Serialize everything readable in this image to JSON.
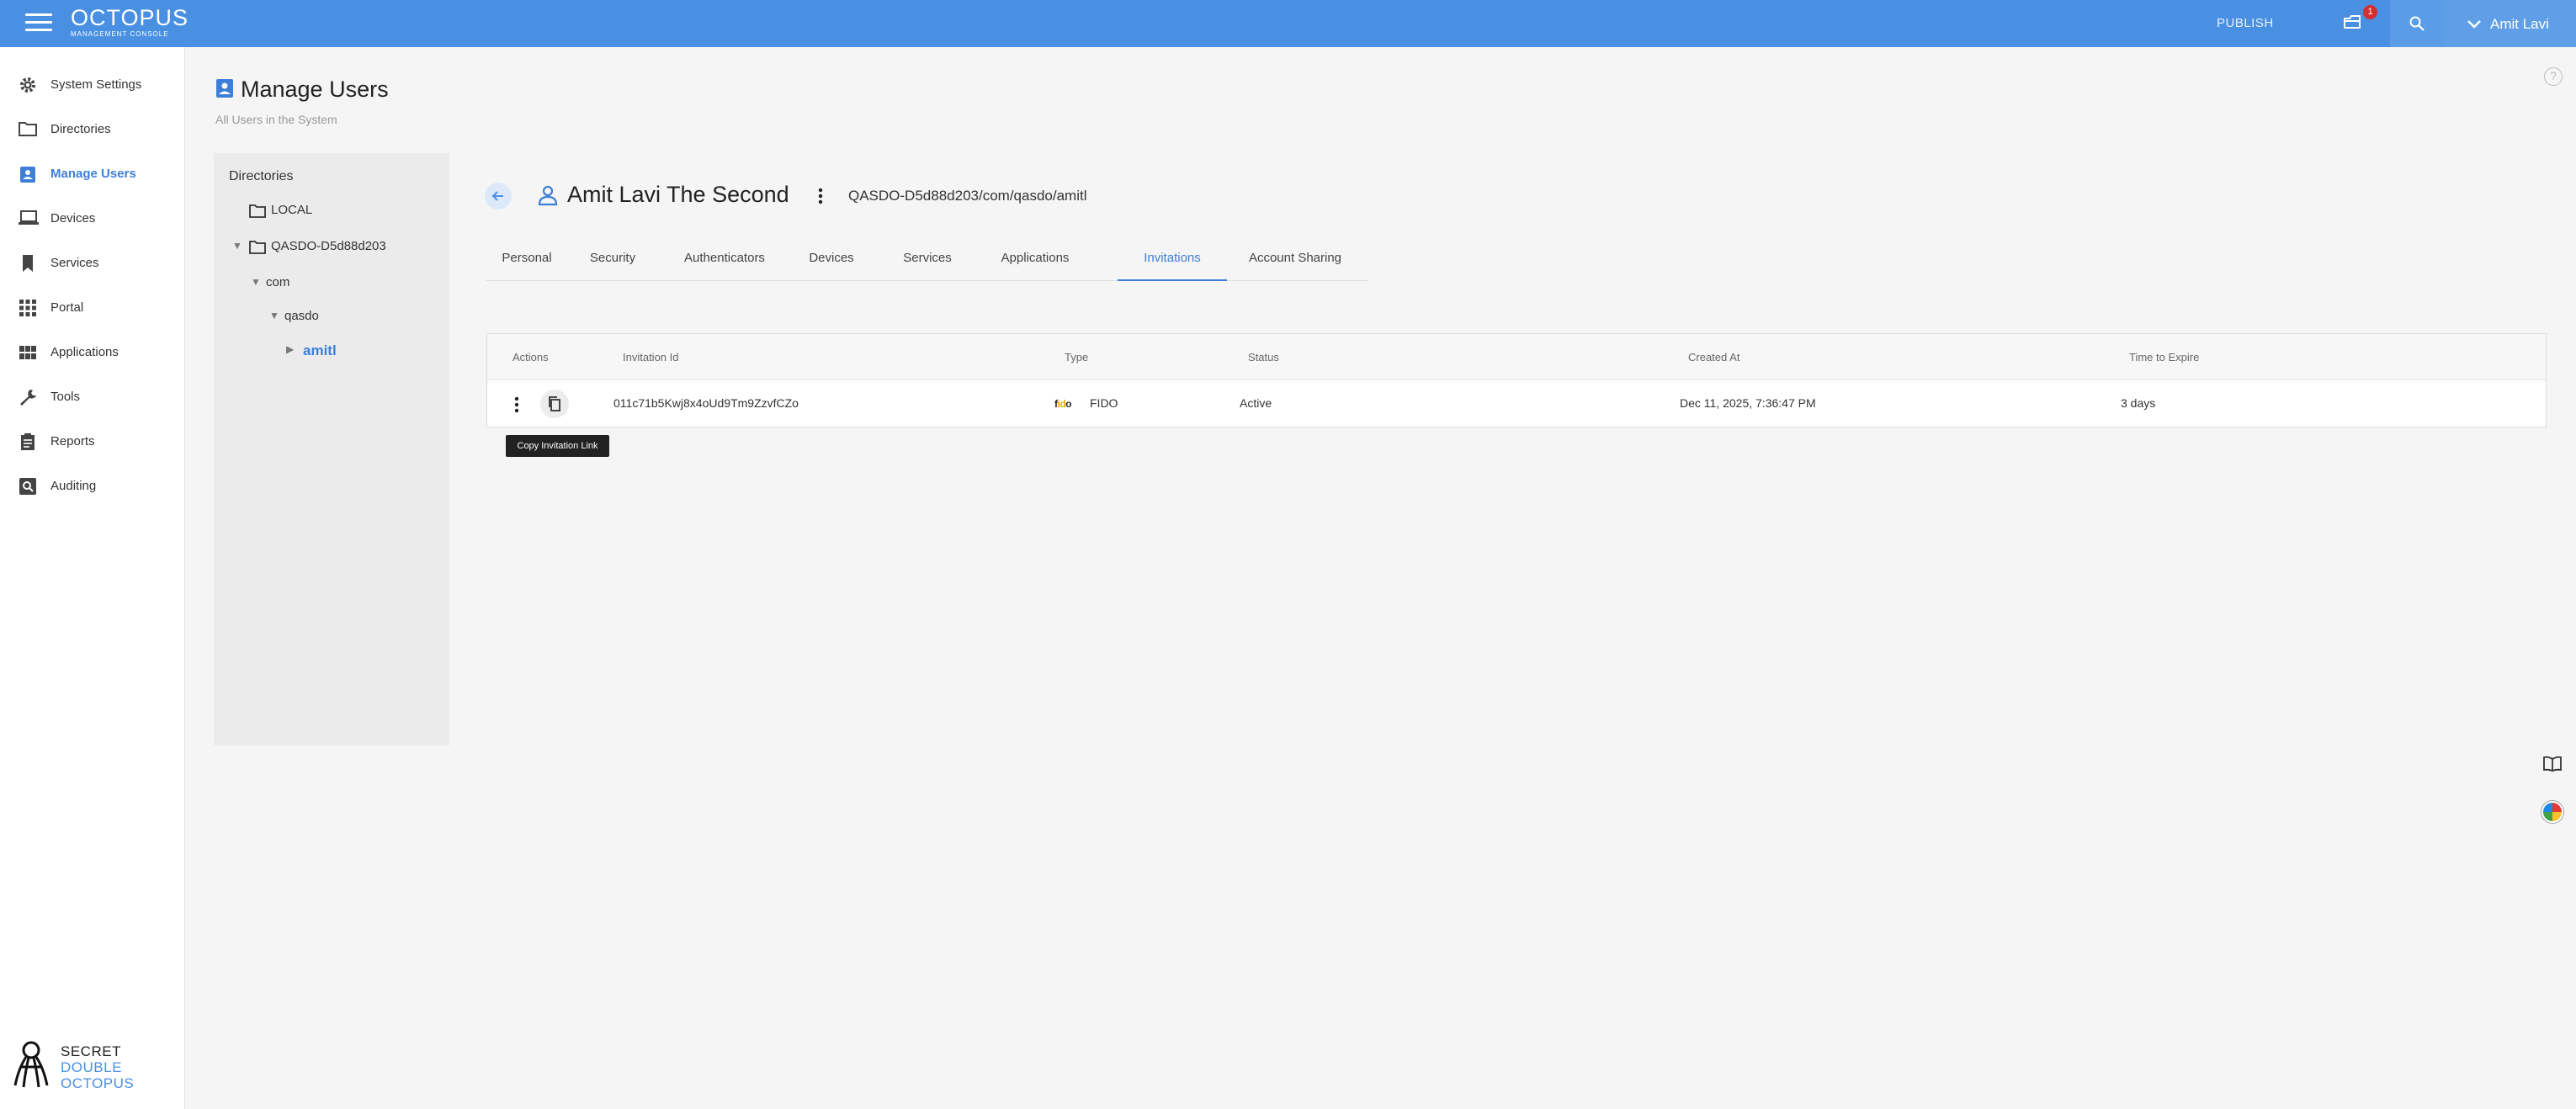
{
  "topbar": {
    "brand_title": "OCTOPUS",
    "brand_subtitle": "MANAGEMENT CONSOLE",
    "publish_label": "PUBLISH",
    "inbox_badge": "1",
    "user_name": "Amit Lavi"
  },
  "sidebar": {
    "items": [
      {
        "label": "System Settings",
        "icon": "gear-icon"
      },
      {
        "label": "Directories",
        "icon": "folder-icon"
      },
      {
        "label": "Manage Users",
        "icon": "user-badge-icon"
      },
      {
        "label": "Devices",
        "icon": "laptop-icon"
      },
      {
        "label": "Services",
        "icon": "bookmark-icon"
      },
      {
        "label": "Portal",
        "icon": "grid-icon"
      },
      {
        "label": "Applications",
        "icon": "apps-icon"
      },
      {
        "label": "Tools",
        "icon": "wrench-icon"
      },
      {
        "label": "Reports",
        "icon": "clipboard-icon"
      },
      {
        "label": "Auditing",
        "icon": "audit-search-icon"
      }
    ],
    "active": "Manage Users",
    "logo_lines": [
      "SECRET",
      "DOUBLE",
      "OCTOPUS"
    ]
  },
  "page": {
    "title": "Manage Users",
    "subtitle": "All Users in the System"
  },
  "tree": {
    "title": "Directories",
    "nodes": [
      {
        "label": "LOCAL"
      },
      {
        "label": "QASDO-D5d88d203"
      },
      {
        "label": "com"
      },
      {
        "label": "qasdo"
      },
      {
        "label": "amitl"
      }
    ],
    "selected": "amitl"
  },
  "user": {
    "name": "Amit Lavi The Second",
    "path": "QASDO-D5d88d203/com/qasdo/amitl"
  },
  "tabs": [
    {
      "label": "Personal"
    },
    {
      "label": "Security"
    },
    {
      "label": "Authenticators"
    },
    {
      "label": "Devices"
    },
    {
      "label": "Services"
    },
    {
      "label": "Applications"
    },
    {
      "label": "Invitations"
    },
    {
      "label": "Account Sharing"
    }
  ],
  "active_tab": "Invitations",
  "table": {
    "headers": [
      "Actions",
      "Invitation Id",
      "Type",
      "Status",
      "Created At",
      "Time to Expire"
    ],
    "rows": [
      {
        "invitation_id": "011c71b5Kwj8x4oUd9Tm9ZzvfCZo",
        "type_logo": "fido",
        "type": "FIDO",
        "status": "Active",
        "created_at": "Dec 11, 2025, 7:36:47 PM",
        "time_to_expire": "3 days"
      }
    ]
  },
  "tooltip": "Copy Invitation Link",
  "colors": {
    "topbar": "#4a90e2",
    "accent": "#3d7fd6",
    "badge": "#d32f2f"
  }
}
